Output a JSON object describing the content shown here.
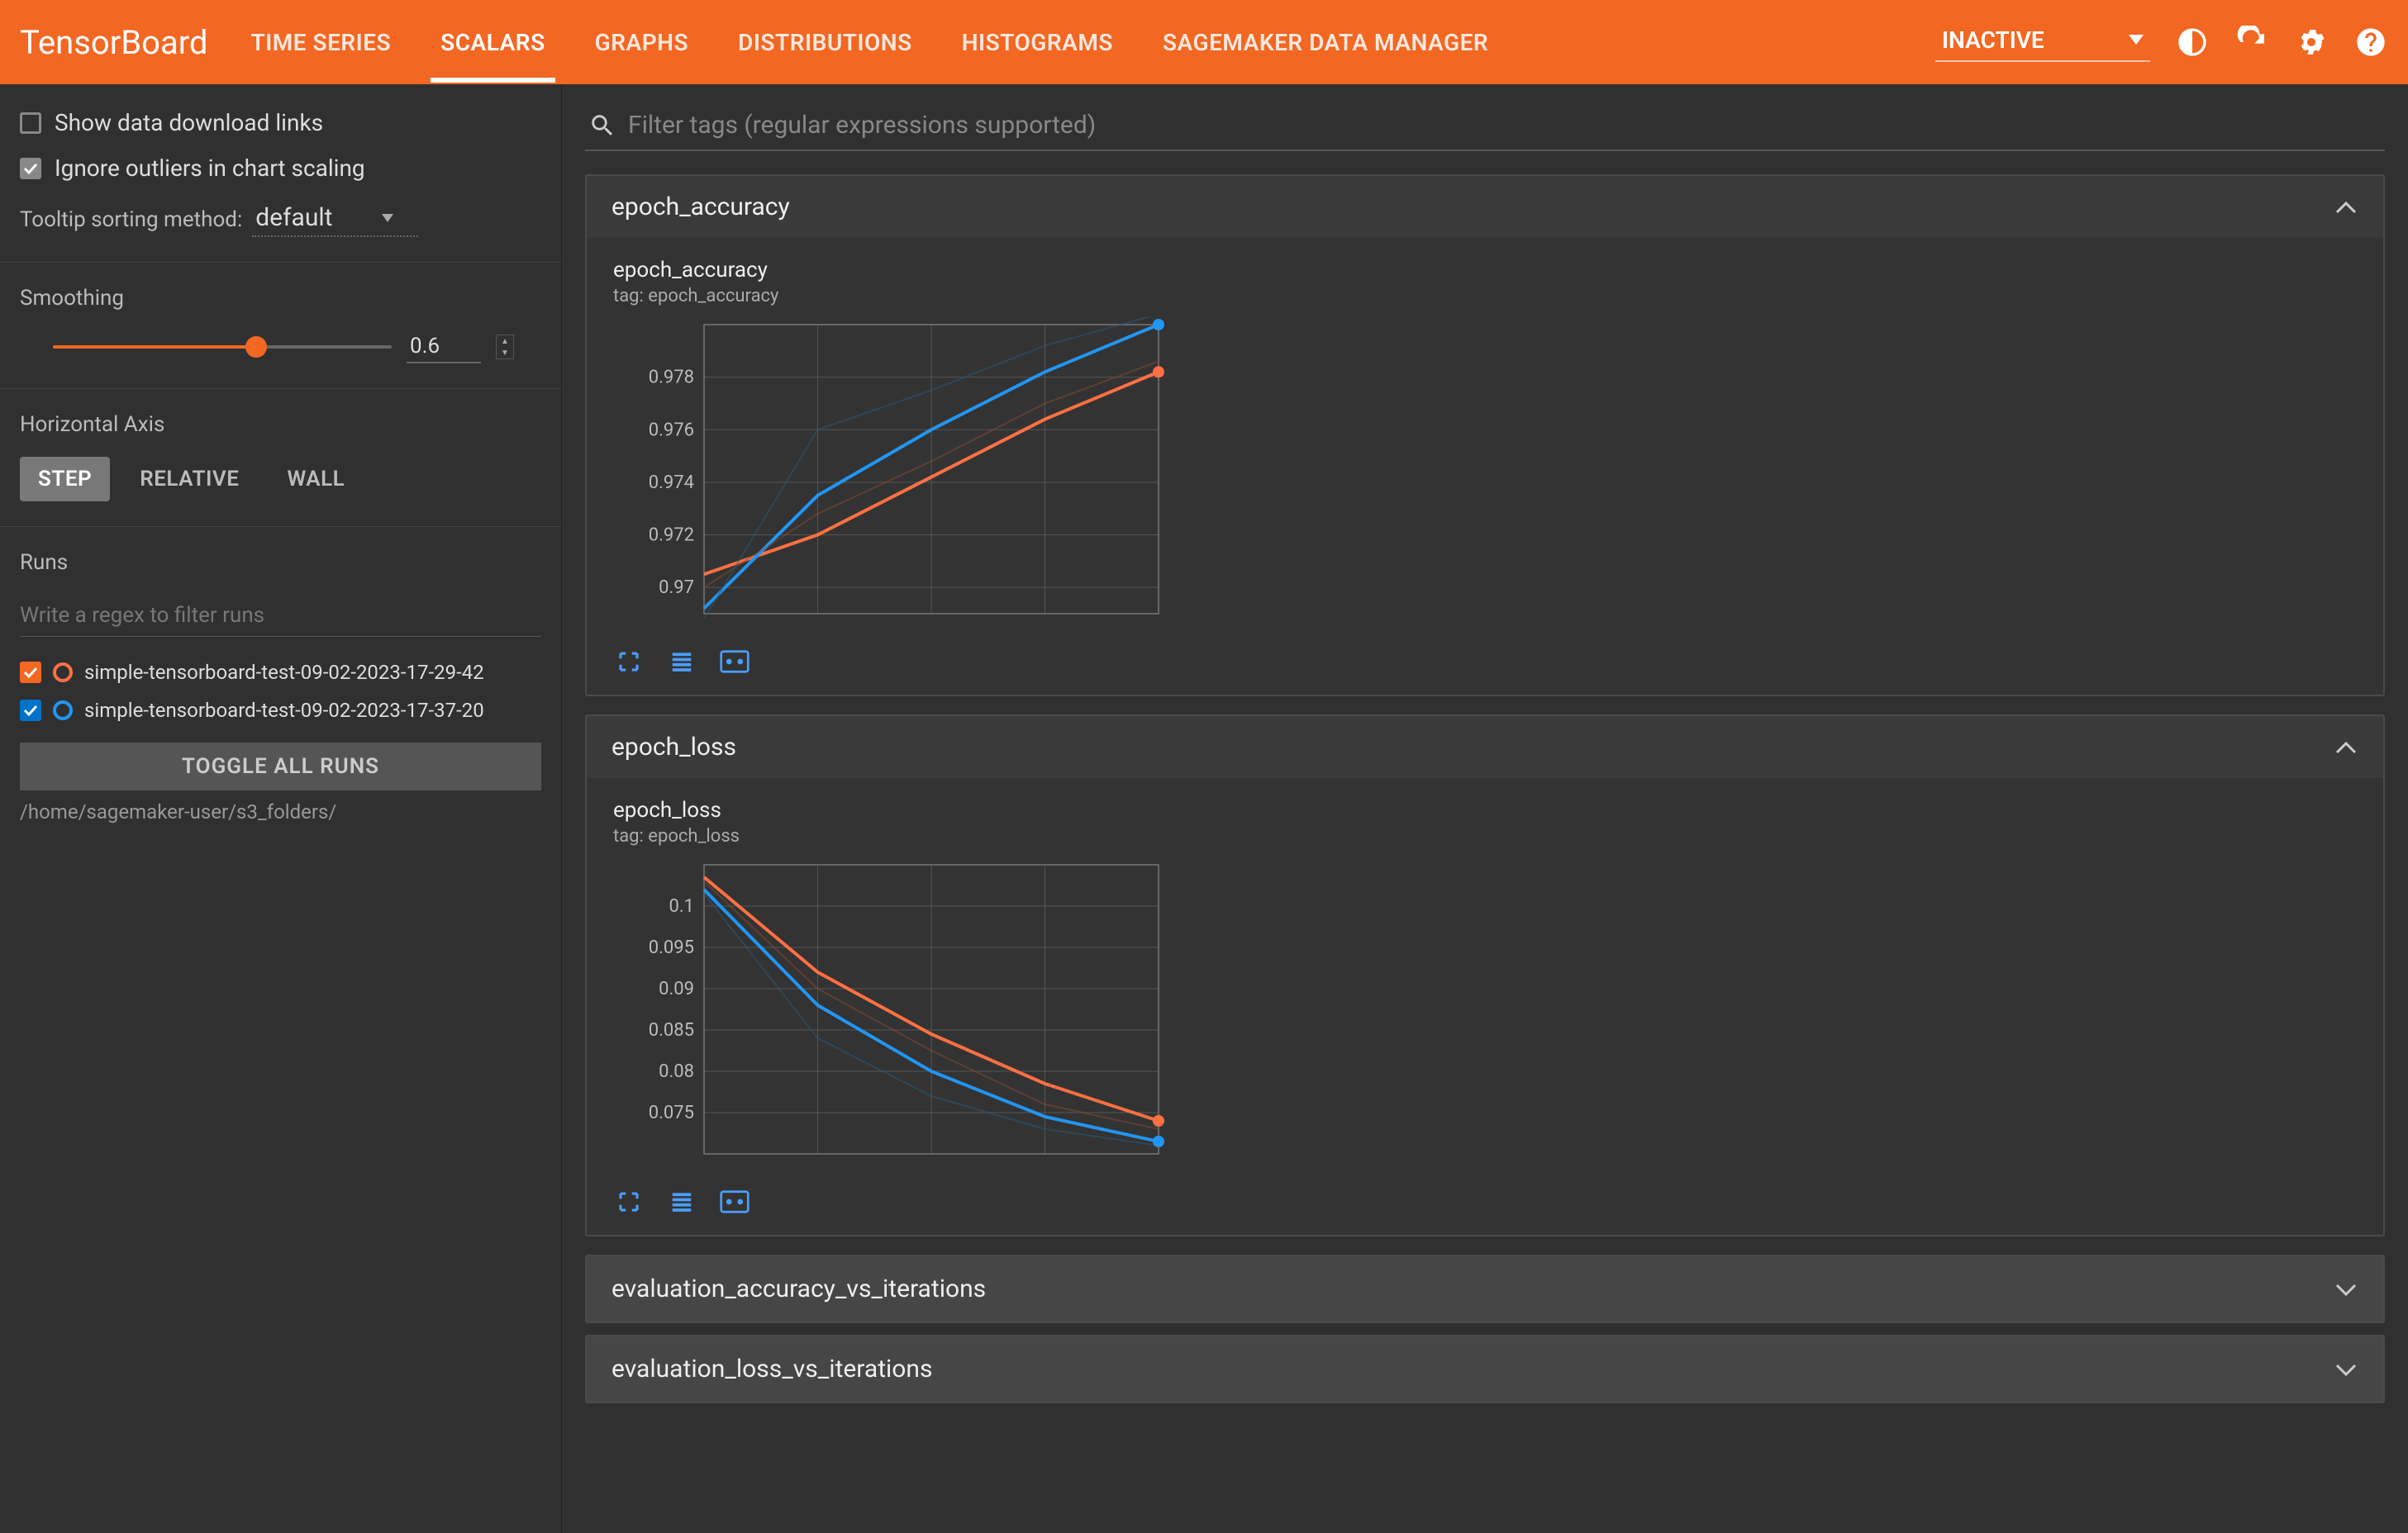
{
  "header": {
    "logo": "TensorBoard",
    "tabs": [
      "TIME SERIES",
      "SCALARS",
      "GRAPHS",
      "DISTRIBUTIONS",
      "HISTOGRAMS",
      "SAGEMAKER DATA MANAGER"
    ],
    "active_tab": "SCALARS",
    "status": "INACTIVE"
  },
  "sidebar": {
    "show_download_label": "Show data download links",
    "ignore_outliers_label": "Ignore outliers in chart scaling",
    "tooltip_sort_label": "Tooltip sorting method:",
    "tooltip_sort_value": "default",
    "smoothing_label": "Smoothing",
    "smoothing_value": "0.6",
    "horizontal_axis_label": "Horizontal Axis",
    "axis_options": [
      "STEP",
      "RELATIVE",
      "WALL"
    ],
    "axis_active": "STEP",
    "runs_label": "Runs",
    "runs_filter_placeholder": "Write a regex to filter runs",
    "runs": [
      {
        "name": "simple-tensorboard-test-09-02-2023-17-29-42",
        "color": "orange",
        "checked": true
      },
      {
        "name": "simple-tensorboard-test-09-02-2023-17-37-20",
        "color": "blue",
        "checked": true
      }
    ],
    "toggle_all_label": "TOGGLE ALL RUNS",
    "path": "/home/sagemaker-user/s3_folders/"
  },
  "content": {
    "filter_placeholder": "Filter tags (regular expressions supported)",
    "panels": [
      {
        "title": "epoch_accuracy",
        "chart_title": "epoch_accuracy",
        "chart_subtitle": "tag: epoch_accuracy",
        "expanded": true
      },
      {
        "title": "epoch_loss",
        "chart_title": "epoch_loss",
        "chart_subtitle": "tag: epoch_loss",
        "expanded": true
      }
    ],
    "collapsed": [
      "evaluation_accuracy_vs_iterations",
      "evaluation_loss_vs_iterations"
    ]
  },
  "chart_data": [
    {
      "type": "line",
      "title": "epoch_accuracy",
      "xlabel": "",
      "ylabel": "",
      "ylim": [
        0.969,
        0.98
      ],
      "xlim": [
        0,
        4
      ],
      "yticks": [
        0.97,
        0.972,
        0.974,
        0.976,
        0.978
      ],
      "series": [
        {
          "name": "run-orange-smoothed",
          "color": "#ff7043",
          "values": [
            [
              0,
              0.9705
            ],
            [
              1,
              0.972
            ],
            [
              2,
              0.9742
            ],
            [
              3,
              0.9764
            ],
            [
              4,
              0.9782
            ]
          ]
        },
        {
          "name": "run-blue-smoothed",
          "color": "#2196f3",
          "values": [
            [
              0,
              0.9692
            ],
            [
              1,
              0.9735
            ],
            [
              2,
              0.976
            ],
            [
              3,
              0.9782
            ],
            [
              4,
              0.98
            ]
          ]
        },
        {
          "name": "run-orange-raw",
          "color": "#8a4a32",
          "values": [
            [
              0,
              0.97
            ],
            [
              1,
              0.9728
            ],
            [
              2,
              0.9748
            ],
            [
              3,
              0.977
            ],
            [
              4,
              0.9786
            ]
          ]
        },
        {
          "name": "run-blue-raw",
          "color": "#2a5a7a",
          "values": [
            [
              0,
              0.9688
            ],
            [
              1,
              0.976
            ],
            [
              2,
              0.9775
            ],
            [
              3,
              0.9792
            ],
            [
              4,
              0.9804
            ]
          ]
        }
      ],
      "end_markers": [
        {
          "color": "#ff7043",
          "x": 4,
          "y": 0.9782
        },
        {
          "color": "#2196f3",
          "x": 4,
          "y": 0.98
        }
      ]
    },
    {
      "type": "line",
      "title": "epoch_loss",
      "xlabel": "",
      "ylabel": "",
      "ylim": [
        0.07,
        0.105
      ],
      "xlim": [
        0,
        4
      ],
      "yticks": [
        0.075,
        0.08,
        0.085,
        0.09,
        0.095,
        0.1
      ],
      "series": [
        {
          "name": "run-orange-smoothed",
          "color": "#ff7043",
          "values": [
            [
              0,
              0.1035
            ],
            [
              1,
              0.092
            ],
            [
              2,
              0.0845
            ],
            [
              3,
              0.0785
            ],
            [
              4,
              0.074
            ]
          ]
        },
        {
          "name": "run-blue-smoothed",
          "color": "#2196f3",
          "values": [
            [
              0,
              0.102
            ],
            [
              1,
              0.088
            ],
            [
              2,
              0.08
            ],
            [
              3,
              0.0745
            ],
            [
              4,
              0.0715
            ]
          ]
        },
        {
          "name": "run-orange-raw",
          "color": "#8a4a32",
          "values": [
            [
              0,
              0.103
            ],
            [
              1,
              0.09
            ],
            [
              2,
              0.0825
            ],
            [
              3,
              0.076
            ],
            [
              4,
              0.073
            ]
          ]
        },
        {
          "name": "run-blue-raw",
          "color": "#2a5a7a",
          "values": [
            [
              0,
              0.1015
            ],
            [
              1,
              0.084
            ],
            [
              2,
              0.077
            ],
            [
              3,
              0.073
            ],
            [
              4,
              0.071
            ]
          ]
        }
      ],
      "end_markers": [
        {
          "color": "#ff7043",
          "x": 4,
          "y": 0.074
        },
        {
          "color": "#2196f3",
          "x": 4,
          "y": 0.0715
        }
      ]
    }
  ]
}
